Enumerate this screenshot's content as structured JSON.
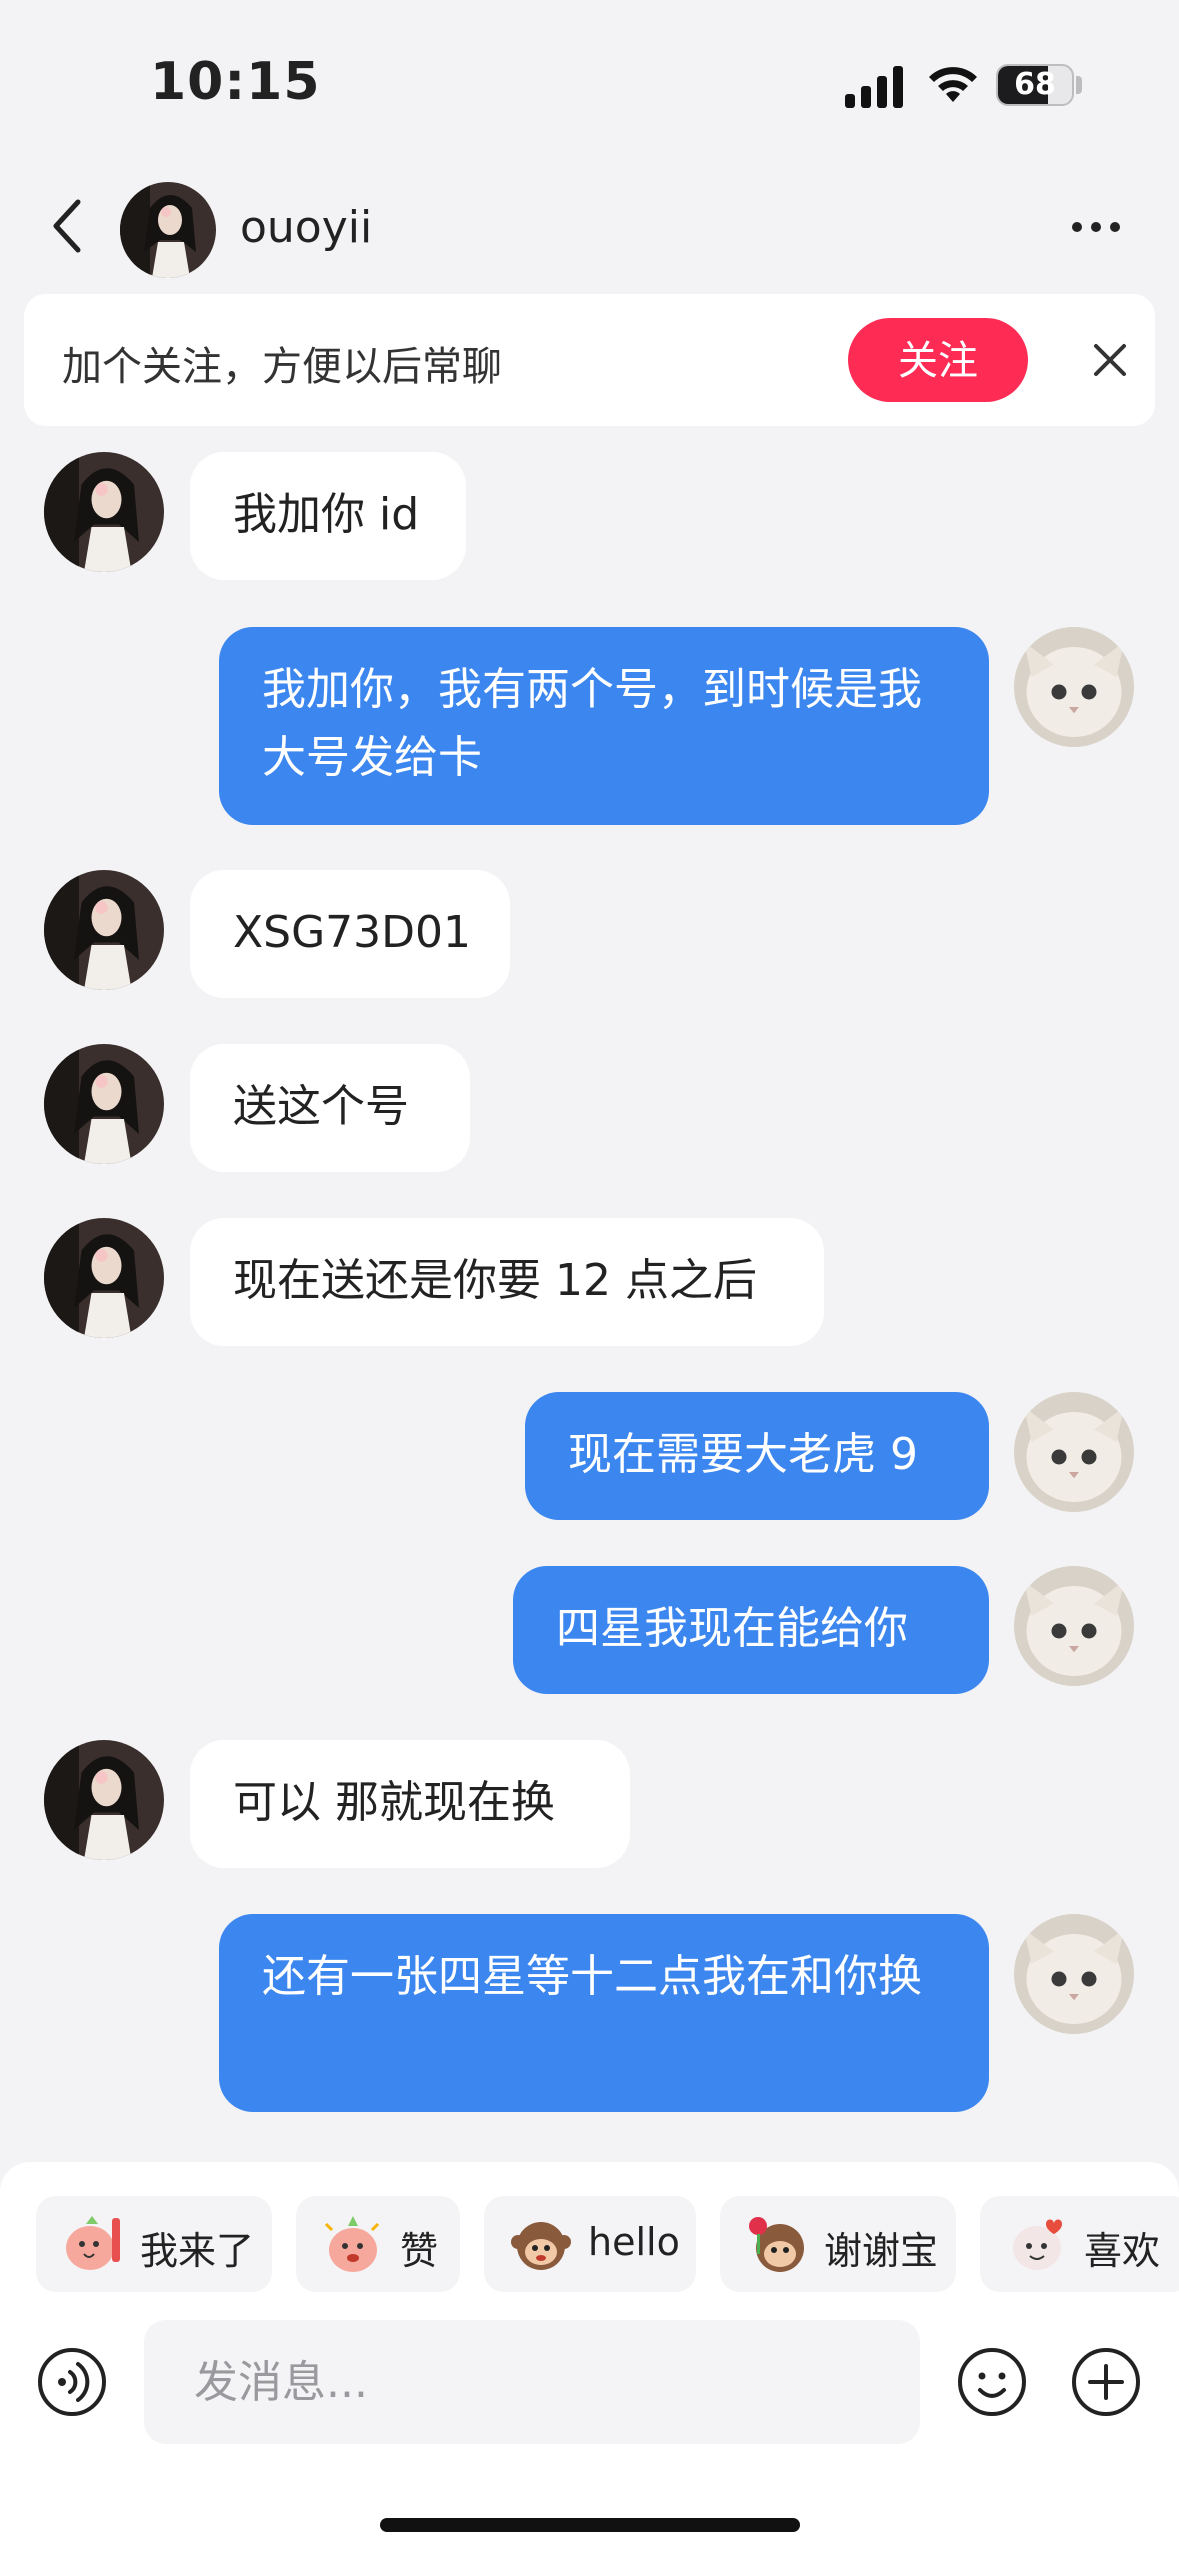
{
  "status_bar": {
    "time": "10:15",
    "battery": "68",
    "icons": [
      "signal-icon",
      "wifi-icon",
      "battery-icon"
    ]
  },
  "header": {
    "contact_name": "ouoyii",
    "icons": [
      "back-chevron-icon",
      "more-icon"
    ]
  },
  "follow_banner": {
    "text": "加个关注，方便以后常聊",
    "button": "关注",
    "close_icon": "close-icon"
  },
  "messages": [
    {
      "side": "in",
      "text": "我加你 id"
    },
    {
      "side": "out",
      "text": "我加你，我有两个号，到时候是我大号发给卡"
    },
    {
      "side": "in",
      "text": "XSG73D01"
    },
    {
      "side": "in",
      "text": "送这个号"
    },
    {
      "side": "in",
      "text": "现在送还是你要 12 点之后"
    },
    {
      "side": "out",
      "text": "现在需要大老虎 9"
    },
    {
      "side": "out",
      "text": "四星我现在能给你"
    },
    {
      "side": "in",
      "text": "可以 那就现在换"
    },
    {
      "side": "out",
      "text": "还有一张四星等十二点我在和你换"
    }
  ],
  "quick_replies": [
    {
      "label": "我来了",
      "icon": "waving-character-icon"
    },
    {
      "label": "赞",
      "icon": "thumbs-up-character-icon"
    },
    {
      "label": "hello",
      "icon": "monkey-hello-icon"
    },
    {
      "label": "谢谢宝",
      "icon": "monkey-rose-icon"
    },
    {
      "label": "喜欢",
      "icon": "heart-character-icon"
    }
  ],
  "input": {
    "placeholder": "发消息..."
  },
  "colors": {
    "accent": "#fe2c55",
    "outgoing_bubble": "#3c86ef",
    "incoming_bubble": "#ffffff",
    "background": "#f3f3f5"
  }
}
